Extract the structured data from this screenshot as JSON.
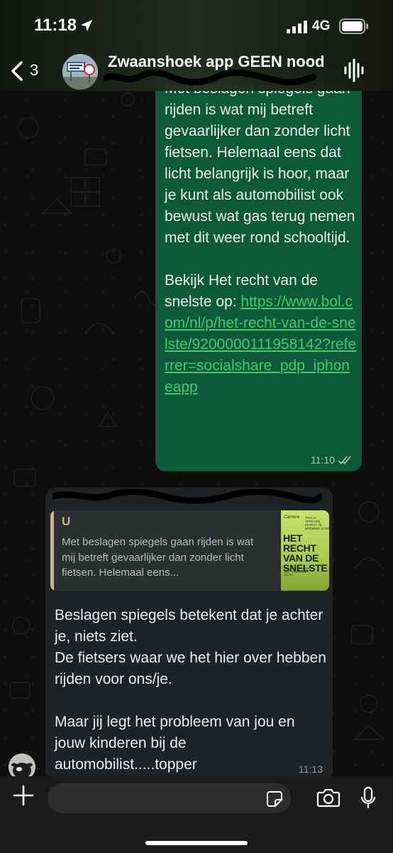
{
  "status_bar": {
    "time": "11:18",
    "network": "4G"
  },
  "header": {
    "back_count": "3",
    "group_name": "Zwaanshoek app GEEN nood"
  },
  "messages": {
    "outgoing": {
      "paragraph1": "Met beslagen spiegels gaan rijden is wat mij betreft gevaarlijker dan zonder licht fietsen. Helemaal eens dat licht belangrijk is hoor, maar je kunt als automobilist ook bewust wat gas terug nemen met dit weer rond schooltijd.",
      "paragraph2_prefix": "Bekijk Het recht van de snelste op: ",
      "link": "https://www.bol.com/nl/p/het-recht-van-de-snelste/9200000111958142?referrer=socialshare_pdp_iphoneapp",
      "time": "11:10"
    },
    "incoming": {
      "quote_author": "U",
      "quote_text": "Met beslagen spiegels gaan rijden is wat mij betreft gevaarlijker dan zonder licht fietsen. Helemaal eens...",
      "book": {
        "publisher": "Carrera",
        "authors": "THALIA VERKADE MARCO TE BRÖMMELSTROET",
        "title": "HET RECHT VAN DE SNELSTE",
        "tagline": "HOE ONS VERKEER ZICH TEGEN ONS KEERT"
      },
      "line1": "Beslagen spiegels betekent dat je achter je, niets ziet.",
      "line2": "De fietsers waar we het hier over hebben rijden voor ons/je.",
      "line3": "Maar jij legt het probleem van jou en jouw kinderen bij de automobilist.....topper",
      "time": "11:13"
    }
  },
  "composer": {
    "placeholder": ""
  },
  "colors": {
    "outgoing_bubble": "#0d5a3b",
    "incoming_bubble": "#1f2325",
    "link": "#44c86e",
    "quote_accent": "#c8b286"
  }
}
